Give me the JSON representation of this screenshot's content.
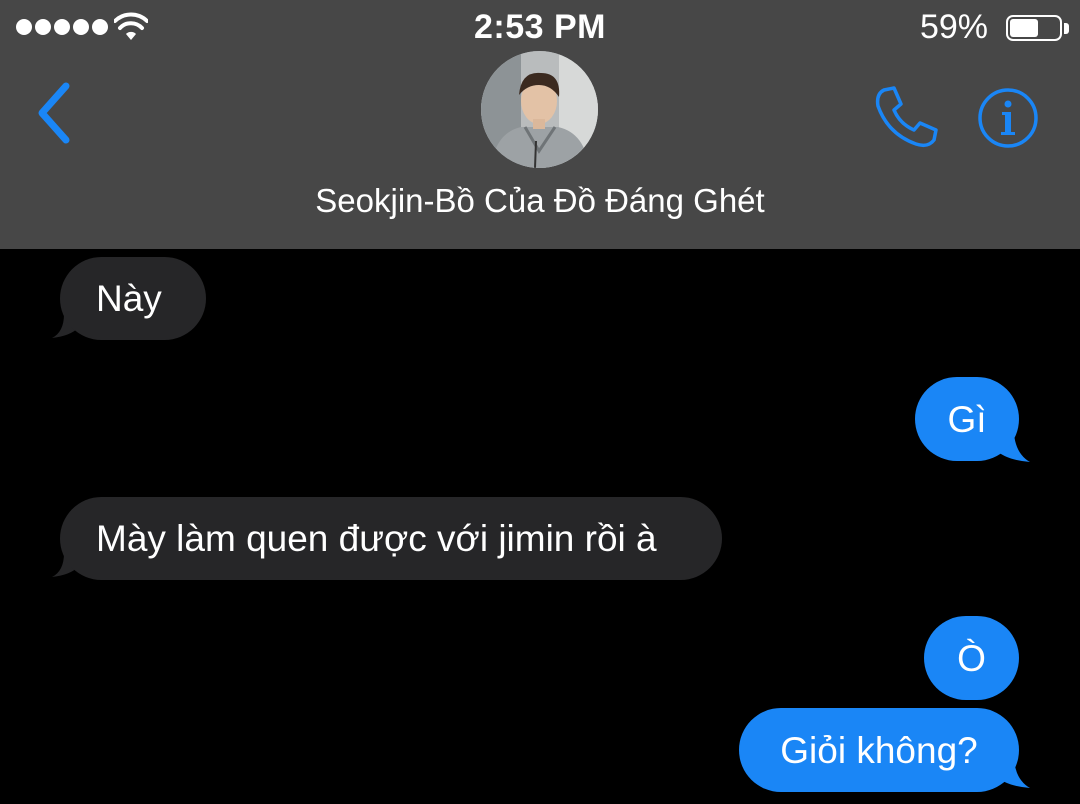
{
  "status_bar": {
    "time": "2:53 PM",
    "battery_percent": "59%",
    "battery_level": 0.59,
    "signal_dots": 5,
    "icons": [
      "signal-dots-icon",
      "wifi-icon",
      "battery-icon"
    ]
  },
  "header": {
    "contact_name": "Seokjin-Bồ Của Đồ Đáng Ghét",
    "icons": [
      "back-chevron-icon",
      "phone-icon",
      "info-icon"
    ],
    "accent_color": "#1a86f6",
    "background_color": "#474747"
  },
  "messages": [
    {
      "direction": "incoming",
      "text": "Này"
    },
    {
      "direction": "outgoing",
      "text": "Gì"
    },
    {
      "direction": "incoming",
      "text": "Mày làm quen được với jimin rồi à"
    },
    {
      "direction": "outgoing",
      "text": "Ò"
    },
    {
      "direction": "outgoing",
      "text": "Giỏi không?"
    }
  ],
  "colors": {
    "incoming_bubble": "#262628",
    "outgoing_bubble": "#1a86f6",
    "background": "#000000"
  }
}
